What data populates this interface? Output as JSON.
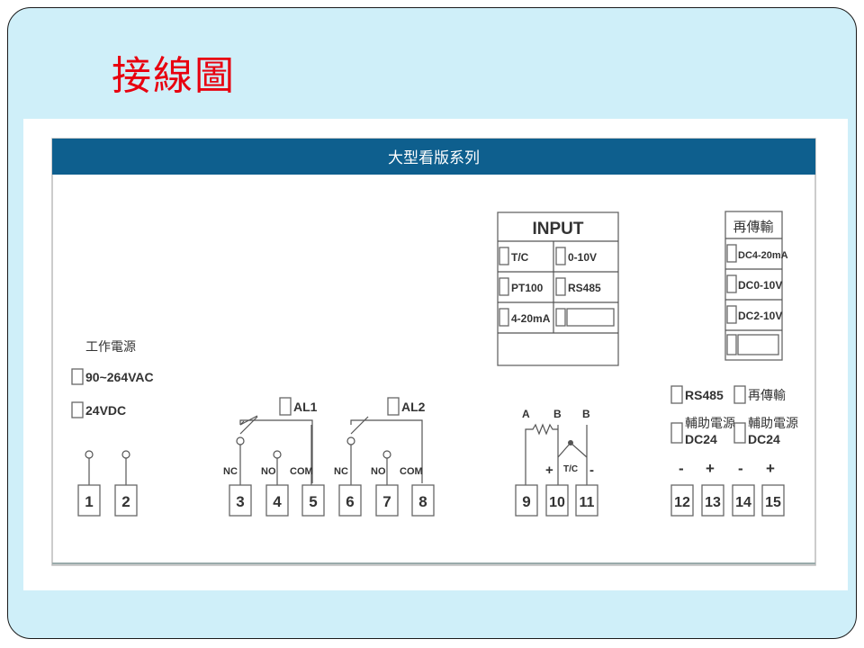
{
  "slide_title": "接線圖",
  "diagram": {
    "header_title": "大型看版系列",
    "power": {
      "heading": "工作電源",
      "options": [
        "90~264VAC",
        "24VDC"
      ]
    },
    "input_table": {
      "title": "INPUT",
      "options": [
        "T/C",
        "0-10V",
        "PT100",
        "RS485",
        "4-20mA",
        ""
      ]
    },
    "retrans_table": {
      "title": "再傳輸",
      "options": [
        "DC4-20mA",
        "DC0-10V",
        "DC2-10V",
        ""
      ]
    },
    "alarms": [
      "AL1",
      "AL2"
    ],
    "relay_labels": [
      "NC",
      "NO",
      "COM",
      "NC",
      "NO",
      "COM"
    ],
    "sensor_labels": {
      "a": "A",
      "b1": "B",
      "b2": "B",
      "plus": "+",
      "tc": "T/C",
      "minus": "-"
    },
    "output_options": [
      "RS485",
      "再傳輸"
    ],
    "aux_label_1": "輔助電源",
    "aux_label_2": "DC24",
    "polarity": [
      "-",
      "+",
      "-",
      "+"
    ],
    "terminals": [
      "1",
      "2",
      "3",
      "4",
      "5",
      "6",
      "7",
      "8",
      "9",
      "10",
      "11",
      "12",
      "13",
      "14",
      "15"
    ]
  }
}
